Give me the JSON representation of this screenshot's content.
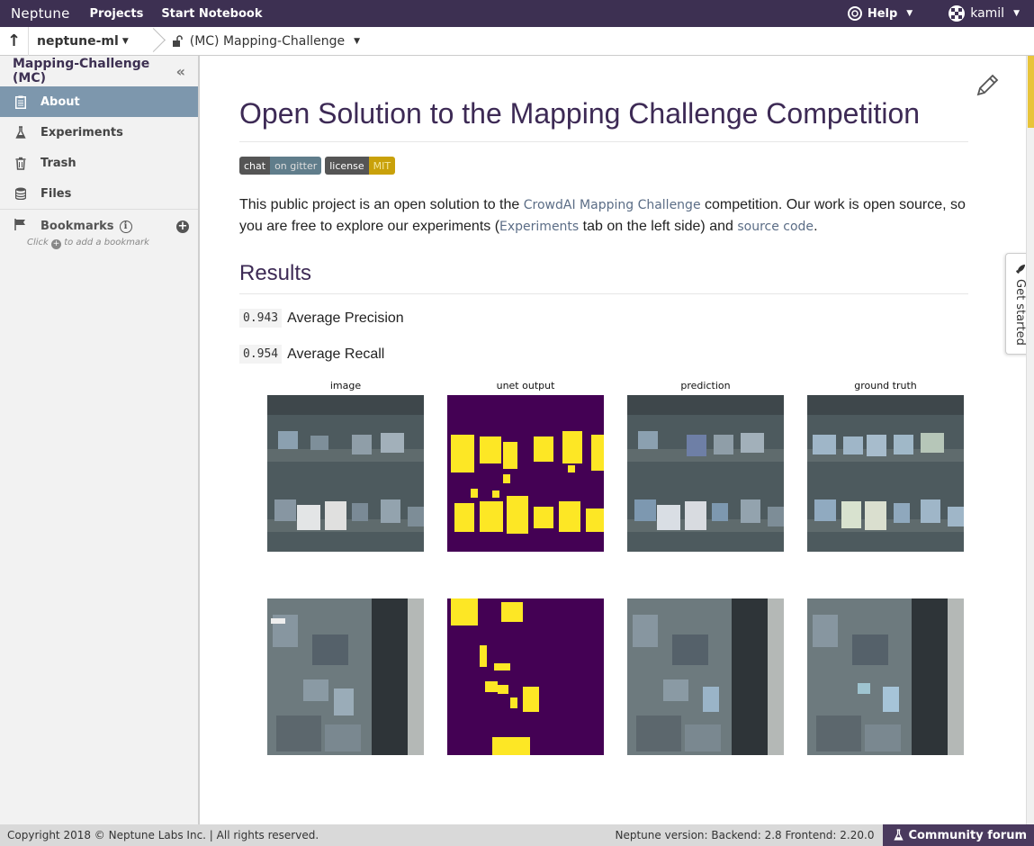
{
  "topbar": {
    "logo": "Neptune",
    "nav": [
      "Projects",
      "Start Notebook"
    ],
    "help_label": "Help",
    "user_name": "kamil"
  },
  "breadcrumb": {
    "organization": "neptune-ml",
    "project": "(MC) Mapping-Challenge"
  },
  "sidebar": {
    "title": "Mapping-Challenge (MC)",
    "items": [
      {
        "label": "About",
        "icon": "document-icon",
        "active": true
      },
      {
        "label": "Experiments",
        "icon": "flask-icon",
        "active": false
      },
      {
        "label": "Trash",
        "icon": "trash-icon",
        "active": false
      },
      {
        "label": "Files",
        "icon": "database-icon",
        "active": false
      }
    ],
    "bookmarks_label": "Bookmarks",
    "bookmark_hint_pre": "Click",
    "bookmark_hint_post": "to add a bookmark"
  },
  "main": {
    "title": "Open Solution to the Mapping Challenge Competition",
    "badges": [
      {
        "left": "chat",
        "right": "on gitter"
      },
      {
        "left": "license",
        "right": "MIT"
      }
    ],
    "intro": {
      "t1": "This public project is an open solution to the ",
      "link1": "CrowdAI Mapping Challenge",
      "t2": " competition. Our work is open source, so you are free to explore our experiments (",
      "link2": "Experiments",
      "t3": " tab on the left side) and ",
      "link3": "source code",
      "t4": "."
    },
    "results_heading": "Results",
    "metrics": [
      {
        "value": "0.943",
        "label": "Average Precision"
      },
      {
        "value": "0.954",
        "label": "Average Recall"
      }
    ],
    "figure_captions": [
      "image",
      "unet output",
      "prediction",
      "ground truth"
    ]
  },
  "get_started": "Get started",
  "footer": {
    "copyright": "Copyright 2018 © Neptune Labs Inc. | All rights reserved.",
    "version": "Neptune version: Backend: 2.8 Frontend: 2.20.0",
    "forum": "Community forum"
  },
  "colors": {
    "topbar": "#3d3052",
    "sidebar_active": "#7d97ad",
    "mask_background": "#440154",
    "mask_foreground": "#fde725"
  }
}
